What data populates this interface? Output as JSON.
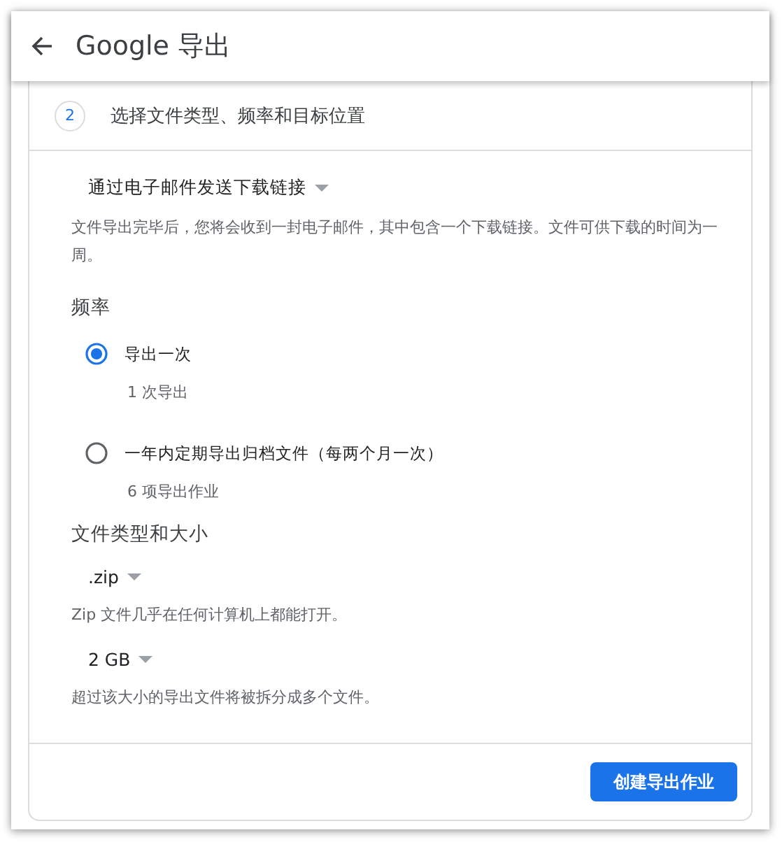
{
  "header": {
    "title": "Google 导出"
  },
  "step": {
    "number": "2",
    "title": "选择文件类型、频率和目标位置"
  },
  "delivery": {
    "value": "通过电子邮件发送下载链接",
    "description": "文件导出完毕后，您将会收到一封电子邮件，其中包含一个下载链接。文件可供下载的时间为一周。"
  },
  "frequency": {
    "heading": "频率",
    "options": [
      {
        "label": "导出一次",
        "detail": "1 次导出",
        "selected": true
      },
      {
        "label": "一年内定期导出归档文件（每两个月一次）",
        "detail": "6 项导出作业",
        "selected": false
      }
    ]
  },
  "file_type": {
    "heading": "文件类型和大小",
    "type_value": ".zip",
    "type_description": "Zip 文件几乎在任何计算机上都能打开。",
    "size_value": "2 GB",
    "size_description": "超过该大小的导出文件将被拆分成多个文件。"
  },
  "button": "创建导出作业"
}
